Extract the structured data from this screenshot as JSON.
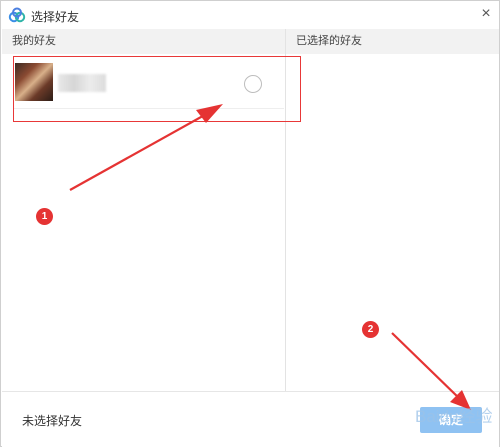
{
  "window": {
    "title": "选择好友",
    "close_glyph": "×",
    "icon": "cloud-logo-icon"
  },
  "left_panel": {
    "header": "我的好友",
    "friends": [
      {
        "avatar_icon": "avatar",
        "name_blurred": true,
        "selected": false
      }
    ]
  },
  "right_panel": {
    "header": "已选择的好友"
  },
  "footer": {
    "status": "未选择好友",
    "confirm_label": "确定"
  },
  "annotations": {
    "markers": [
      "1",
      "2"
    ],
    "highlight_color": "#e53333"
  },
  "watermark": {
    "text": "Baidu经验"
  },
  "colors": {
    "accent": "#8fc2f2",
    "annotation": "#e53333",
    "panel_header_bg": "#f2f2f2"
  }
}
